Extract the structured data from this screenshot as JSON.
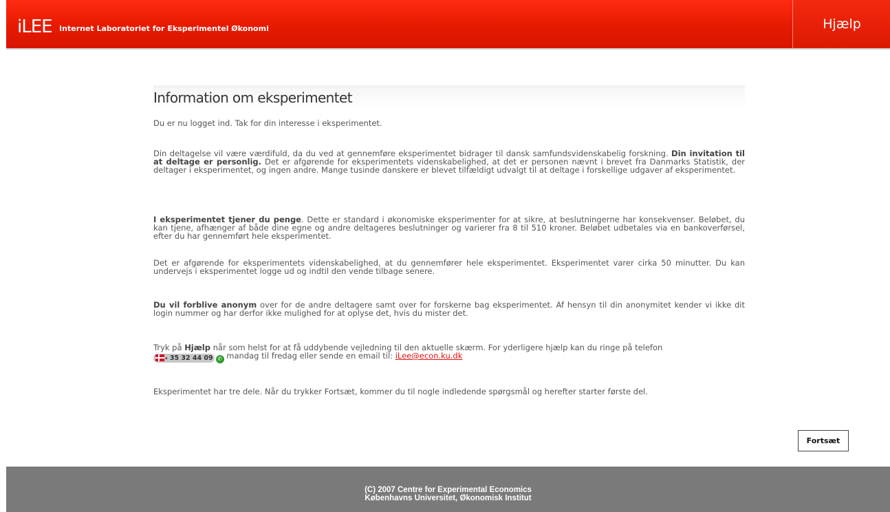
{
  "header": {
    "logo": "iLEE",
    "subtitle": "Internet Laboratoriet for Eksperimentel Økonomi",
    "help_label": "Hjælp"
  },
  "main": {
    "title": "Information om eksperimentet",
    "p0": "Du er nu logget ind. Tak for din interesse i eksperimentet.",
    "p1_a": "Din deltagelse vil være værdifuld, da du ved at gennemføre eksperimentet bidrager til dansk samfundsvidenskabelig forskning. ",
    "p1_b": "Din invitation til at deltage er personlig.",
    "p1_c": " Det er afgørende for eksperimentets videnskabelighed, at det er personen nævnt i brevet fra Danmarks Statistik, der deltager i eksperimentet, og ingen andre. Mange tusinde danskere er blevet tilfældigt udvalgt til at deltage i forskellige udgaver af eksperimentet.",
    "p2_a": "I eksperimentet tjener du penge",
    "p2_b": ". Dette er standard i økonomiske eksperimenter for at sikre, at beslutningerne har konsekvenser. Beløbet, du kan tjene, afhænger af både dine egne og andre deltageres beslutninger og varierer fra 8 til 510 kroner. Beløbet udbetales via en bankoverførsel, efter du har gennemført hele eksperimentet.",
    "p3": "Det er afgørende for eksperimentets videnskabelighed, at du gennemfører hele eksperimentet. Eksperimentet varer cirka 50 minutter. Du kan undervejs i eksperimentet logge ud og indtil den vende tilbage senere.",
    "p4_a": "Du vil forblive anonym",
    "p4_b": " over for de andre deltagere samt over for forskerne bag eksperimentet. Af hensyn til din anonymitet kender vi ikke dit login nummer og har derfor ikke mulighed for at oplyse det, hvis du mister det.",
    "p5_a": "Tryk på ",
    "p5_b": "Hjælp",
    "p5_c": " når som helst for at få uddybende vejledning til den aktuelle skærm. For yderligere hjælp kan du ringe på telefon",
    "phone": "35 32 44 09",
    "p5_d": " mandag til fredag eller sende en email til: ",
    "email": "iLee@econ.ku.dk",
    "p6": "Eksperimentet har tre dele. Når du trykker Fortsæt, kommer du til nogle indledende spørgsmål og herefter starter første del."
  },
  "continue_label": "Fortsæt",
  "footer": {
    "line1": "(C) 2007 Centre for Experimental Economics",
    "line2": "Københavns Universitet, Økonomisk Institut"
  },
  "colors": {
    "header_red": "#e61a00",
    "footer_gray": "#7a7a7a",
    "link_red": "#e01010"
  },
  "icons": [
    "danish-flag-icon",
    "dropdown-arrow-icon",
    "phone-call-icon"
  ]
}
